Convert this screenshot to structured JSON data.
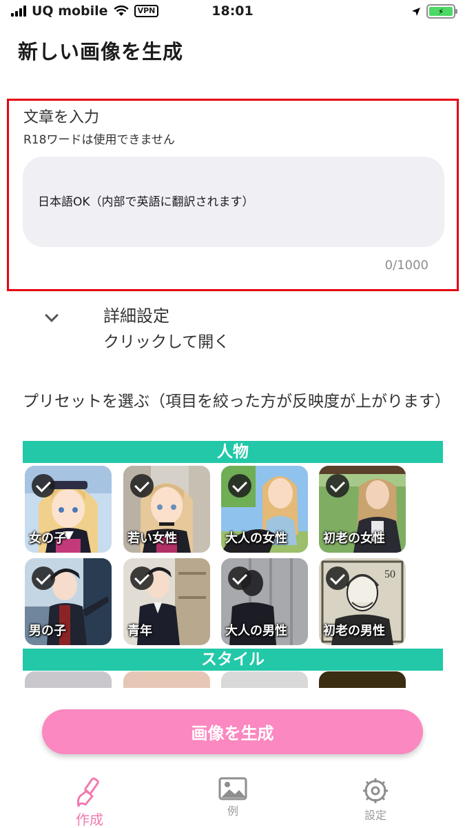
{
  "status_bar": {
    "carrier": "UQ mobile",
    "vpn": "VPN",
    "time": "18:01"
  },
  "page_title": "新しい画像を生成",
  "prompt": {
    "label": "文章を入力",
    "note": "R18ワードは使用できません",
    "placeholder": "日本語OK（内部で英語に翻訳されます）",
    "counter": "0/1000"
  },
  "advanced": {
    "title": "詳細設定",
    "subtitle": "クリックして開く"
  },
  "preset_label": "プリセットを選ぶ（項目を絞った方が反映度が上がります）",
  "categories": {
    "person": {
      "title": "人物",
      "items": [
        {
          "label": "女の子",
          "selected": true
        },
        {
          "label": "若い女性",
          "selected": true
        },
        {
          "label": "大人の女性",
          "selected": true
        },
        {
          "label": "初老の女性",
          "selected": true
        },
        {
          "label": "男の子",
          "selected": true
        },
        {
          "label": "青年",
          "selected": true
        },
        {
          "label": "大人の男性",
          "selected": true
        },
        {
          "label": "初老の男性",
          "selected": true
        }
      ]
    },
    "style": {
      "title": "スタイル"
    }
  },
  "generate_button": "画像を生成",
  "tabs": [
    {
      "label": "作成",
      "icon": "brush-icon",
      "active": true
    },
    {
      "label": "例",
      "icon": "image-icon",
      "active": false
    },
    {
      "label": "設定",
      "icon": "gear-icon",
      "active": false
    }
  ],
  "colors": {
    "accent": "#22c8a8",
    "button": "#fb88c0",
    "active_tab": "#f27aaf",
    "highlight_border": "#e60012"
  }
}
